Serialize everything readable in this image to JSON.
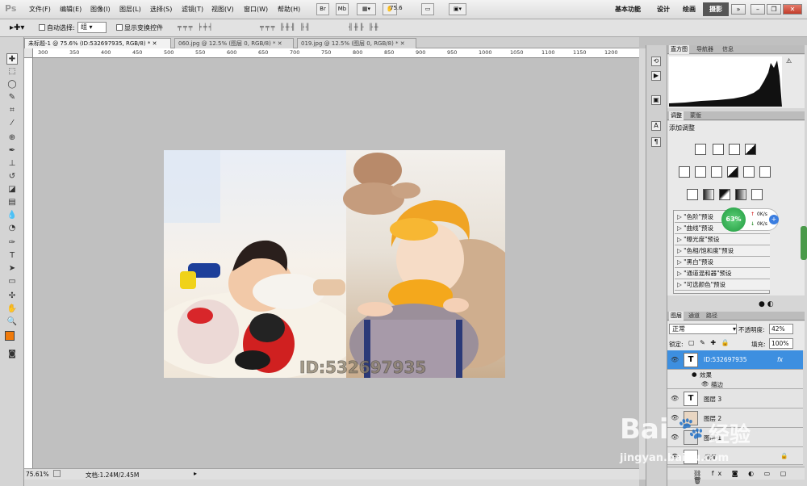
{
  "app": {
    "logo": "Ps"
  },
  "menus": [
    "文件(F)",
    "编辑(E)",
    "图像(I)",
    "图层(L)",
    "选择(S)",
    "滤镜(T)",
    "视图(V)",
    "窗口(W)",
    "帮助(H)"
  ],
  "menubar_tools": {
    "bridge": "Br",
    "minibridge": "Mb",
    "zoom_value": "75.6"
  },
  "workspaces": [
    "基本功能",
    "设计",
    "绘画"
  ],
  "workspace_active": "摄影",
  "options_bar": {
    "auto_select_label": "自动选择:",
    "auto_select_value": "组",
    "transform_label": "显示变换控件"
  },
  "doc_tabs": [
    {
      "label": "未标题-1 @ 75.6% (ID:532697935, RGB/8) *",
      "active": true
    },
    {
      "label": "060.jpg @ 12.5% (图层 0, RGB/8) *",
      "active": false
    },
    {
      "label": "019.jpg @ 12.5% (图层 0, RGB/8) *",
      "active": false
    }
  ],
  "ruler_top": [
    "300",
    "350",
    "400",
    "450",
    "500",
    "550",
    "600",
    "650",
    "700",
    "750",
    "800",
    "850",
    "900",
    "950",
    "1000",
    "1050",
    "1100",
    "1150",
    "1200"
  ],
  "watermark_text": "ID:532697935",
  "status": {
    "zoom": "75.61%",
    "doc_info": "文档:1.24M/2.45M"
  },
  "panels": {
    "histogram_tabs": [
      "直方图",
      "导航器",
      "信息"
    ],
    "adjust_tabs": [
      "调整",
      "蒙版"
    ],
    "add_adjustment": "添加调整",
    "presets": [
      "\"色阶\"预设",
      "\"曲线\"预设",
      "\"曝光度\"预设",
      "\"色相/饱和度\"预设",
      "\"黑白\"预设",
      "\"通道混和器\"预设",
      "\"可选颜色\"预设"
    ],
    "layers_tabs": [
      "图层",
      "通道",
      "路径"
    ],
    "blend_mode": "正常",
    "opacity_label": "不透明度:",
    "opacity_value": "42%",
    "lock_label": "锁定:",
    "fill_label": "填充:",
    "fill_value": "100%",
    "layers": [
      {
        "name": "ID:532697935",
        "selected": true,
        "fx": "fx"
      },
      {
        "name": "效果",
        "sub": true
      },
      {
        "name": "描边",
        "sub2": true
      },
      {
        "name": "图层 3"
      },
      {
        "name": "图层 2"
      },
      {
        "name": "图层 1"
      },
      {
        "name": "背景"
      }
    ]
  },
  "net_widget": {
    "percent": "63%",
    "up": "0K/s",
    "down": "0K/s"
  },
  "site_watermark": {
    "brand": "Bai",
    "brand2": "经验",
    "url": "jingyan.baidu.com"
  },
  "colors": {
    "foreground": "#f07a0a",
    "background": "#ffffff",
    "selection": "#3d8fe0"
  }
}
